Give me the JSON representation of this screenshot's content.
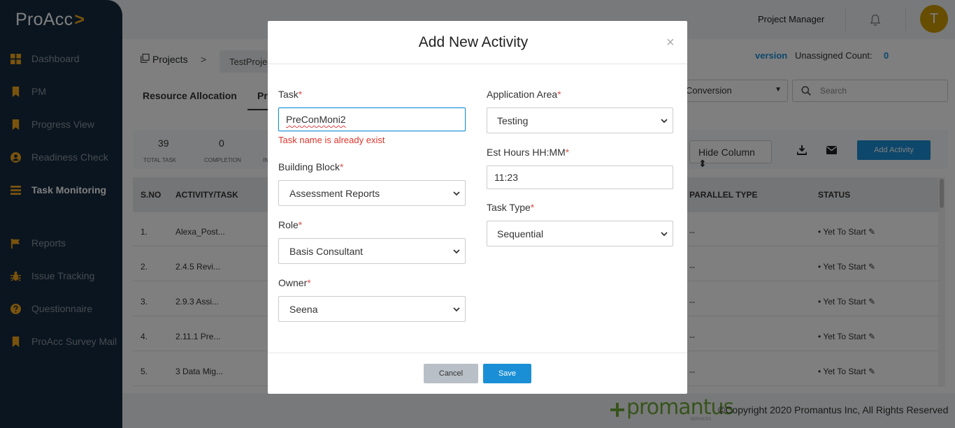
{
  "app": {
    "logo_text": "ProAcc",
    "logo_chevron": ">"
  },
  "sidebar": {
    "items": [
      {
        "label": "Dashboard"
      },
      {
        "label": "PM"
      },
      {
        "label": "Progress View"
      },
      {
        "label": "Readiness Check"
      },
      {
        "label": "Task Monitoring"
      },
      {
        "label": "Reports"
      },
      {
        "label": "Issue Tracking"
      },
      {
        "label": "Questionnaire"
      },
      {
        "label": "ProAcc Survey Mail"
      }
    ]
  },
  "header": {
    "role": "Project Manager",
    "avatar_initial": "T"
  },
  "breadcrumb": {
    "projects": "Projects",
    "separator": ">",
    "project": "TestProject"
  },
  "summary": {
    "conversion_link": "version",
    "unassigned_label": "Unassigned Count:",
    "unassigned_value": "0"
  },
  "tabs": {
    "resource_allocation": "Resource Allocation",
    "progress_partial": "Pr"
  },
  "filters": {
    "conversion_select": "Conversion",
    "search_placeholder": "Search"
  },
  "stats": {
    "total_value": "39",
    "total_label": "TOTAL TASK",
    "completion_value": "0",
    "completion_label": "COMPLETION",
    "partial_label": "IN"
  },
  "toolbar": {
    "hide_column": "Hide Column",
    "add_activity": "Add Activity"
  },
  "table": {
    "headers": {
      "sno": "S.NO",
      "activity": "ACTIVITY/TASK",
      "parallel": "PARALLEL TYPE",
      "status": "STATUS"
    },
    "rows": [
      {
        "sno": "1.",
        "task": "Alexa_Post...",
        "parallel": "--",
        "status": "Yet To Start"
      },
      {
        "sno": "2.",
        "task": "2.4.5 Revi...",
        "parallel": "--",
        "status": "Yet To Start"
      },
      {
        "sno": "3.",
        "task": "2.9.3 Assi...",
        "parallel": "--",
        "status": "Yet To Start"
      },
      {
        "sno": "4.",
        "task": "2.11.1 Pre...",
        "parallel": "--",
        "status": "Yet To Start"
      },
      {
        "sno": "5.",
        "task": "3 Data Mig...",
        "parallel": "--",
        "status": "Yet To Start"
      }
    ]
  },
  "footer": {
    "brand": "promantus",
    "brand_sub": "SERVICES",
    "copyright": "©Copyright 2020 Promantus Inc, All Rights Reserved"
  },
  "modal": {
    "title": "Add New Activity",
    "close": "×",
    "required_mark": "*",
    "task": {
      "label": "Task",
      "value": "PreConMoni2",
      "error": "Task name is already exist"
    },
    "building_block": {
      "label": "Building Block",
      "value": "Assessment Reports"
    },
    "role": {
      "label": "Role",
      "value": "Basis Consultant"
    },
    "owner": {
      "label": "Owner",
      "value": "Seena"
    },
    "application_area": {
      "label": "Application Area",
      "value": "Testing"
    },
    "est_hours": {
      "label": "Est Hours HH:MM",
      "value": "11:23"
    },
    "task_type": {
      "label": "Task Type",
      "value": "Sequential"
    },
    "cancel": "Cancel",
    "save": "Save"
  },
  "colors": {
    "sidebar_bg": "#152a3f",
    "accent": "#1a8fd6",
    "avatar": "#cc9b00",
    "logo_chevron": "#f3a71c",
    "error": "#d9362b",
    "brand": "#6fa83b"
  }
}
